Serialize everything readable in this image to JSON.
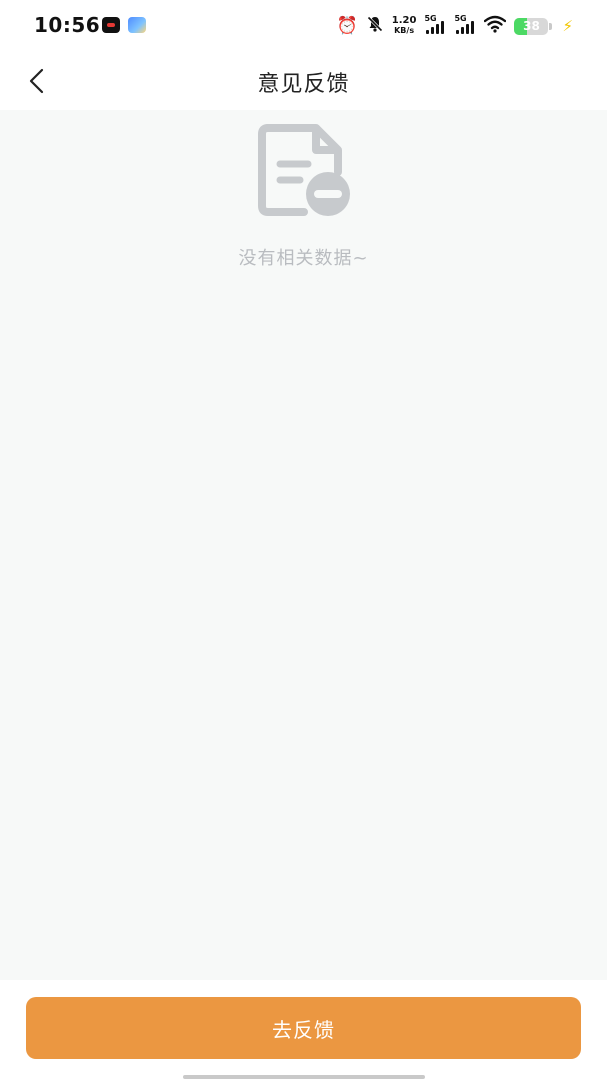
{
  "status_bar": {
    "time": "10:56",
    "network_speed_value": "1.20",
    "network_speed_unit": "KB/s",
    "signal_1_tag": "5G",
    "signal_2_tag": "5G",
    "battery_level": "38",
    "icons": [
      "red-app-icon",
      "blue-app-icon",
      "alarm-icon",
      "mute-bell-icon",
      "signal-icon",
      "signal-icon",
      "wifi-icon",
      "battery-icon",
      "charging-icon"
    ]
  },
  "nav": {
    "back_icon": "chevron-left-icon",
    "title": "意见反馈"
  },
  "empty_state": {
    "icon": "document-minus-icon",
    "message": "没有相关数据~"
  },
  "footer": {
    "button_label": "去反馈"
  },
  "colors": {
    "accent": "#eb9741",
    "background": "#f7f9f8",
    "empty_text": "#b9bcc0",
    "empty_icon": "#c7cacd"
  }
}
